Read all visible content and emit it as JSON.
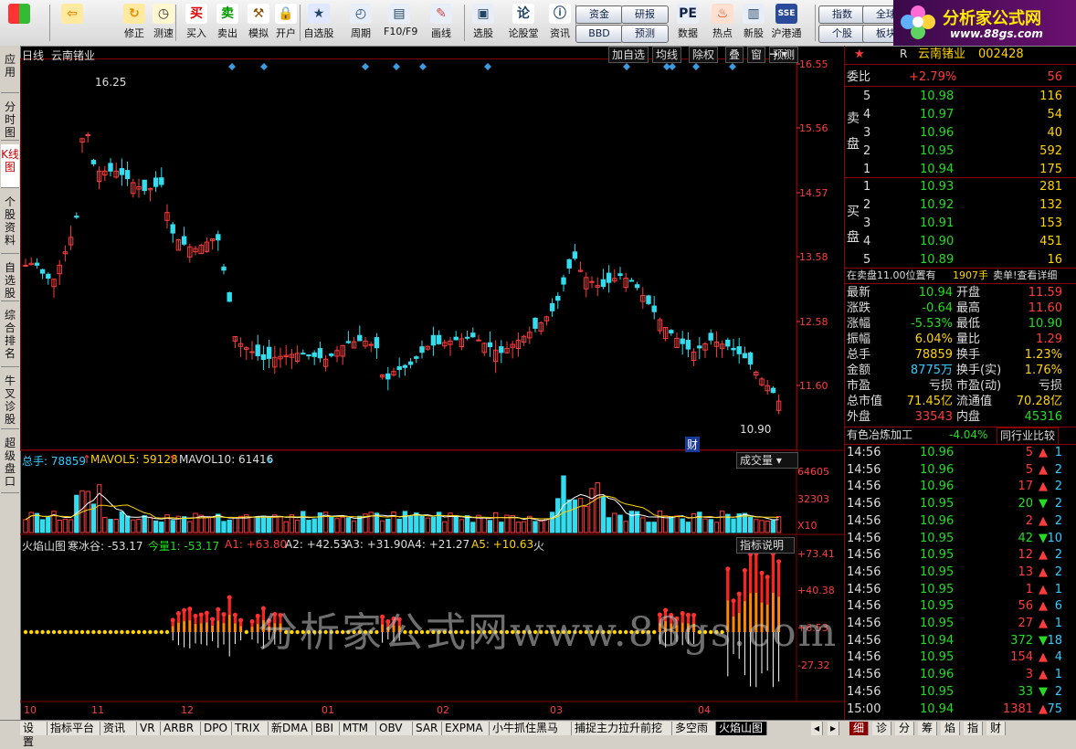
{
  "toolbar": {
    "buttons": [
      {
        "label": "",
        "icon": "windows-logo-icon"
      },
      {
        "label": "",
        "icon": "back-arrow-icon"
      },
      {
        "label": "修正",
        "icon": "refresh-icon"
      },
      {
        "label": "测速",
        "icon": "clock-icon"
      },
      {
        "label": "买入",
        "icon": "buy-icon",
        "glyph": "买"
      },
      {
        "label": "卖出",
        "icon": "sell-icon",
        "glyph": "卖"
      },
      {
        "label": "模拟",
        "icon": "hammer-icon"
      },
      {
        "label": "开户",
        "icon": "lock-icon"
      },
      {
        "label": "自选股",
        "icon": "star-folder-icon"
      },
      {
        "label": "周期",
        "icon": "clock-cycle-icon"
      },
      {
        "label": "F10/F9",
        "icon": "document-icon"
      },
      {
        "label": "画线",
        "icon": "pencil-icon"
      },
      {
        "label": "选股",
        "icon": "monitor-icon"
      },
      {
        "label": "论股堂",
        "icon": "forum-icon",
        "glyph": "论"
      },
      {
        "label": "资讯",
        "icon": "info-icon"
      },
      {
        "label": "数据",
        "icon": "pe-icon",
        "glyph": "PE"
      },
      {
        "label": "热点",
        "icon": "hot-icon"
      },
      {
        "label": "新股",
        "icon": "ipo-icon"
      },
      {
        "label": "沪港通",
        "icon": "sse-hk-icon"
      }
    ],
    "pills": [
      "资金",
      "研报",
      "BBD",
      "预测",
      "指数",
      "全球",
      "个股",
      "板块"
    ]
  },
  "logo": {
    "title": "分析家公式网",
    "url": "www.88gs.com"
  },
  "sidebar": {
    "tabs": [
      "应用",
      "分时图",
      "K线图",
      "个股资料",
      "自选股",
      "综合排名",
      "牛叉诊股",
      "超级盘口"
    ],
    "active": "K线图"
  },
  "chart": {
    "period": "日线",
    "stock_name": "云南锗业",
    "right_buttons": [
      "加自选",
      "均线",
      "除权",
      "叠",
      "窗",
      "预测"
    ],
    "price_axis": [
      "16.55",
      "15.56",
      "14.57",
      "13.58",
      "12.58",
      "11.60"
    ],
    "max_label": "16.25",
    "min_label": "10.90",
    "fin_badge": "财",
    "vol_legend": {
      "a": "总手: 78859",
      "b": "MAVOL5: 59128",
      "c": "MAVOL10: 61416"
    },
    "vol_axis": [
      "64605",
      "32303",
      "X10"
    ],
    "vol_button": "成交量",
    "ind_legend": {
      "name": "火焰山图",
      "h": "寒冰谷: -53.17",
      "j": "今量1: -53.17",
      "a1": "A1: +63.80",
      "a2": "A2: +42.53",
      "a3": "A3: +31.90",
      "a4": "A4: +21.27",
      "a5": "A5: +10.63",
      "fire": "火"
    },
    "ind_button": "指标说明",
    "ind_axis": [
      "+73.41",
      "+40.38",
      "+6.53",
      "-27.32"
    ],
    "x_months": [
      "10",
      "11",
      "12",
      "01",
      "02",
      "03",
      "04"
    ],
    "watermark": "分析家公式网www.88gs.com",
    "colors": {
      "up": "#ff3b3b",
      "down": "#33ddee",
      "grid": "#800000",
      "ma5": "#ffffff",
      "ma10": "#ffd400"
    }
  },
  "quote": {
    "title": "云南锗业",
    "code": "002428",
    "weibi_label": "委比",
    "weibi": "+2.79%",
    "weibi_vol": "56",
    "sell_label": "卖盘",
    "buy_label": "买盘",
    "asks": [
      {
        "lv": "5",
        "price": "10.98",
        "vol": "116"
      },
      {
        "lv": "4",
        "price": "10.97",
        "vol": "54"
      },
      {
        "lv": "3",
        "price": "10.96",
        "vol": "40"
      },
      {
        "lv": "2",
        "price": "10.95",
        "vol": "592"
      },
      {
        "lv": "1",
        "price": "10.94",
        "vol": "175"
      }
    ],
    "bids": [
      {
        "lv": "1",
        "price": "10.93",
        "vol": "281"
      },
      {
        "lv": "2",
        "price": "10.92",
        "vol": "132"
      },
      {
        "lv": "3",
        "price": "10.91",
        "vol": "153"
      },
      {
        "lv": "4",
        "price": "10.90",
        "vol": "451"
      },
      {
        "lv": "5",
        "price": "10.89",
        "vol": "16"
      }
    ],
    "position_note": "在卖盘11.00位置有",
    "position_vol": "1907手",
    "position_tail": "卖单!查看详细",
    "stats": [
      {
        "l": "最新",
        "v": "10.94",
        "c": "c-grn",
        "l2": "开盘",
        "v2": "11.59",
        "c2": "c-red"
      },
      {
        "l": "涨跌",
        "v": "-0.64",
        "c": "c-grn",
        "l2": "最高",
        "v2": "11.60",
        "c2": "c-red"
      },
      {
        "l": "涨幅",
        "v": "-5.53%",
        "c": "c-grn",
        "l2": "最低",
        "v2": "10.90",
        "c2": "c-grn"
      },
      {
        "l": "振幅",
        "v": "6.04%",
        "c": "c-yel",
        "l2": "量比",
        "v2": "1.29",
        "c2": "c-red"
      },
      {
        "l": "总手",
        "v": "78859",
        "c": "c-yel",
        "l2": "换手",
        "v2": "1.23%",
        "c2": "c-yel"
      },
      {
        "l": "金额",
        "v": "8775万",
        "c": "c-cyan",
        "l2": "换手(实)",
        "v2": "1.76%",
        "c2": "c-yel"
      },
      {
        "l": "市盈",
        "v": "亏损",
        "c": "c-wht",
        "l2": "市盈(动)",
        "v2": "亏损",
        "c2": "c-wht"
      },
      {
        "l": "总市值",
        "v": "71.45亿",
        "c": "c-yel",
        "l2": "流通值",
        "v2": "70.28亿",
        "c2": "c-yel"
      },
      {
        "l": "外盘",
        "v": "33543",
        "c": "c-red",
        "l2": "内盘",
        "v2": "45316",
        "c2": "c-grn"
      }
    ],
    "industry": "有色冶炼加工",
    "industry_chg": "-4.04%",
    "industry_btn": "同行业比较",
    "ticks": [
      {
        "t": "14:56",
        "p": "10.96",
        "v": "5",
        "d": "up",
        "n": "1"
      },
      {
        "t": "14:56",
        "p": "10.96",
        "v": "5",
        "d": "up",
        "n": "2"
      },
      {
        "t": "14:56",
        "p": "10.96",
        "v": "17",
        "d": "up",
        "n": "2"
      },
      {
        "t": "14:56",
        "p": "10.95",
        "v": "20",
        "d": "down",
        "n": "2"
      },
      {
        "t": "14:56",
        "p": "10.96",
        "v": "2",
        "d": "up",
        "n": "2"
      },
      {
        "t": "14:56",
        "p": "10.95",
        "v": "42",
        "d": "down",
        "n": "10"
      },
      {
        "t": "14:56",
        "p": "10.95",
        "v": "12",
        "d": "up",
        "n": "2"
      },
      {
        "t": "14:56",
        "p": "10.95",
        "v": "13",
        "d": "up",
        "n": "2"
      },
      {
        "t": "14:56",
        "p": "10.95",
        "v": "1",
        "d": "up",
        "n": "1"
      },
      {
        "t": "14:56",
        "p": "10.95",
        "v": "56",
        "d": "up",
        "n": "6"
      },
      {
        "t": "14:56",
        "p": "10.95",
        "v": "27",
        "d": "up",
        "n": "1"
      },
      {
        "t": "14:56",
        "p": "10.94",
        "v": "372",
        "d": "down",
        "n": "18"
      },
      {
        "t": "14:56",
        "p": "10.95",
        "v": "154",
        "d": "up",
        "n": "4"
      },
      {
        "t": "14:56",
        "p": "10.96",
        "v": "3",
        "d": "up",
        "n": "1"
      },
      {
        "t": "14:56",
        "p": "10.95",
        "v": "33",
        "d": "down",
        "n": "2"
      },
      {
        "t": "15:00",
        "p": "10.94",
        "v": "1381",
        "d": "up",
        "n": "75"
      }
    ]
  },
  "bottom_tabs": [
    "设置",
    "指标平台",
    "资讯",
    "VR",
    "ARBR",
    "DPO",
    "TRIX",
    "新DMA",
    "BBI",
    "MTM",
    "OBV",
    "SAR",
    "EXPMA",
    "小牛抓住黑马",
    "捕捉主力拉升前挖",
    "多空雨",
    "火焰山图"
  ],
  "bottom_active": "火焰山图",
  "side_tabs": [
    "细",
    "诊",
    "分",
    "筹",
    "焰",
    "指",
    "财"
  ],
  "side_active": "细"
}
